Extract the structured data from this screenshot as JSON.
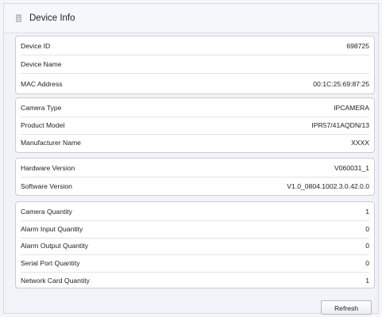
{
  "header": {
    "title": "Device Info",
    "icon": "document-icon"
  },
  "device": {
    "rows": [
      {
        "label": "Device ID",
        "value": "698725"
      },
      {
        "label": "Device Name",
        "value": ""
      },
      {
        "label": "MAC Address",
        "value": "00:1C:25:69:87:25"
      }
    ]
  },
  "camera": {
    "rows": [
      {
        "label": "Camera Type",
        "value": "IPCAMERA"
      },
      {
        "label": "Product Model",
        "value": "IPR57/41AQDN/13"
      },
      {
        "label": "Manufacturer Name",
        "value": "XXXX"
      }
    ]
  },
  "version": {
    "rows": [
      {
        "label": "Hardware Version",
        "value": "V060031_1"
      },
      {
        "label": "Software Version",
        "value": "V1.0_0804.1002.3.0.42.0.0"
      }
    ]
  },
  "quantity": {
    "rows": [
      {
        "label": "Camera Quantity",
        "value": "1"
      },
      {
        "label": "Alarm  Input Quantity",
        "value": "0"
      },
      {
        "label": "Alarm Output Quantity",
        "value": "0"
      },
      {
        "label": "Serial  Port Quantity",
        "value": "0"
      },
      {
        "label": "Network Card  Quantity",
        "value": "1"
      }
    ]
  },
  "actions": {
    "refresh_label": "Refresh"
  }
}
